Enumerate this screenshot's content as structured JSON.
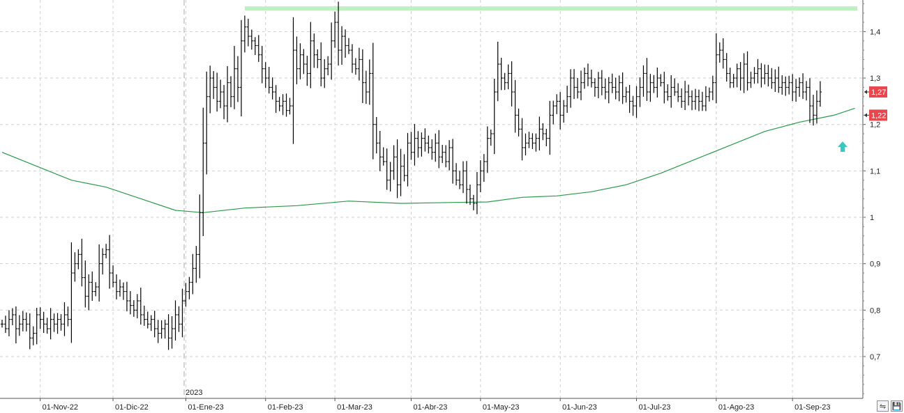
{
  "chart_data": {
    "type": "ohlc",
    "y_ticks": [
      "0,7",
      "0,8",
      "0,9",
      "1",
      "1,1",
      "1,2",
      "1,3",
      "1,4"
    ],
    "y_tick_values": [
      0.7,
      0.8,
      0.9,
      1.0,
      1.1,
      1.2,
      1.3,
      1.4
    ],
    "ylim": [
      0.62,
      1.47
    ],
    "x_tick_labels": [
      "01-Nov-22",
      "01-Dic-22",
      "01-Ene-23",
      "01-Feb-23",
      "01-Mar-23",
      "01-Abr-23",
      "01-May-23",
      "01-Jun-23",
      "01-Jul-23",
      "01-Ago-23",
      "01-Sep-23"
    ],
    "x_tick_bars": [
      11,
      32,
      53,
      76,
      96,
      118,
      138,
      161,
      183,
      206,
      228
    ],
    "year_marker": {
      "label": "2023",
      "bar": 53
    },
    "resistance_level": 1.45,
    "resistance_start_bar": 70,
    "ma_points": [
      [
        0,
        1.14
      ],
      [
        10,
        1.11
      ],
      [
        20,
        1.08
      ],
      [
        30,
        1.065
      ],
      [
        40,
        1.04
      ],
      [
        50,
        1.015
      ],
      [
        58,
        1.01
      ],
      [
        70,
        1.02
      ],
      [
        85,
        1.025
      ],
      [
        100,
        1.035
      ],
      [
        115,
        1.03
      ],
      [
        130,
        1.032
      ],
      [
        140,
        1.033
      ],
      [
        150,
        1.043
      ],
      [
        160,
        1.046
      ],
      [
        170,
        1.055
      ],
      [
        180,
        1.07
      ],
      [
        190,
        1.095
      ],
      [
        200,
        1.125
      ],
      [
        210,
        1.155
      ],
      [
        220,
        1.185
      ],
      [
        230,
        1.205
      ],
      [
        240,
        1.22
      ],
      [
        246,
        1.235
      ]
    ],
    "closes": [
      0.77,
      0.76,
      0.78,
      0.79,
      0.76,
      0.77,
      0.78,
      0.77,
      0.74,
      0.75,
      0.79,
      0.78,
      0.77,
      0.76,
      0.78,
      0.77,
      0.78,
      0.77,
      0.79,
      0.78,
      0.88,
      0.9,
      0.92,
      0.87,
      0.83,
      0.86,
      0.84,
      0.85,
      0.9,
      0.92,
      0.93,
      0.88,
      0.86,
      0.84,
      0.85,
      0.84,
      0.82,
      0.81,
      0.8,
      0.82,
      0.79,
      0.78,
      0.77,
      0.78,
      0.76,
      0.75,
      0.76,
      0.77,
      0.74,
      0.76,
      0.79,
      0.77,
      0.82,
      0.84,
      0.86,
      0.89,
      0.92,
      1.01,
      1.16,
      1.26,
      1.3,
      1.28,
      1.25,
      1.27,
      1.24,
      1.29,
      1.26,
      1.32,
      1.28,
      1.38,
      1.41,
      1.39,
      1.38,
      1.37,
      1.35,
      1.32,
      1.3,
      1.28,
      1.27,
      1.25,
      1.24,
      1.25,
      1.23,
      1.24,
      1.36,
      1.32,
      1.35,
      1.33,
      1.31,
      1.38,
      1.35,
      1.34,
      1.3,
      1.32,
      1.33,
      1.38,
      1.42,
      1.36,
      1.39,
      1.37,
      1.36,
      1.33,
      1.32,
      1.34,
      1.29,
      1.27,
      1.31,
      1.2,
      1.16,
      1.13,
      1.12,
      1.08,
      1.1,
      1.13,
      1.07,
      1.11,
      1.09,
      1.16,
      1.14,
      1.17,
      1.15,
      1.17,
      1.16,
      1.15,
      1.14,
      1.16,
      1.13,
      1.14,
      1.12,
      1.15,
      1.1,
      1.08,
      1.07,
      1.1,
      1.06,
      1.04,
      1.03,
      1.07,
      1.1,
      1.12,
      1.17,
      1.18,
      1.27,
      1.33,
      1.3,
      1.29,
      1.31,
      1.27,
      1.22,
      1.19,
      1.15,
      1.16,
      1.17,
      1.16,
      1.17,
      1.19,
      1.18,
      1.17,
      1.22,
      1.24,
      1.25,
      1.22,
      1.24,
      1.26,
      1.3,
      1.28,
      1.27,
      1.29,
      1.31,
      1.3,
      1.29,
      1.28,
      1.3,
      1.28,
      1.27,
      1.29,
      1.28,
      1.27,
      1.29,
      1.26,
      1.27,
      1.25,
      1.24,
      1.26,
      1.28,
      1.31,
      1.27,
      1.29,
      1.28,
      1.3,
      1.29,
      1.27,
      1.26,
      1.28,
      1.27,
      1.26,
      1.25,
      1.27,
      1.26,
      1.25,
      1.26,
      1.25,
      1.24,
      1.26,
      1.27,
      1.29,
      1.35,
      1.36,
      1.34,
      1.31,
      1.29,
      1.3,
      1.32,
      1.3,
      1.33,
      1.29,
      1.3,
      1.31,
      1.32,
      1.3,
      1.31,
      1.3,
      1.29,
      1.3,
      1.28,
      1.29,
      1.28,
      1.29,
      1.27,
      1.28,
      1.29,
      1.27,
      1.28,
      1.24,
      1.22,
      1.25,
      1.27
    ],
    "last_price_badges": [
      {
        "label": "1,27",
        "value": 1.27
      },
      {
        "label": "1,22",
        "value": 1.22
      }
    ],
    "grid": true,
    "colors": {
      "bars": "#000000",
      "moving_average": "#2a9a4a",
      "resistance": "#bff0c2",
      "badge": "#e8474d",
      "signal_arrow": "#3cc8c0",
      "grid": "#cfcfcf"
    }
  },
  "ui": {
    "zoom_icon": "zoom-fit-icon",
    "save_icon": "save-disk-icon"
  }
}
